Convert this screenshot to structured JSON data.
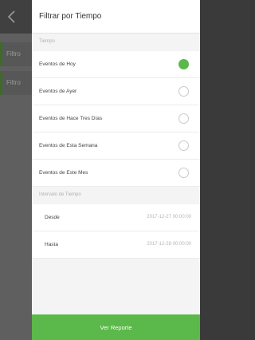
{
  "background_page": {
    "tab1_label": "Filtro",
    "tab2_label": "Filtro"
  },
  "panel": {
    "title": "Filtrar por Tiempo",
    "time_section_label": "Tiempo",
    "time_options": [
      {
        "label": "Eventos de Hoy",
        "selected": true
      },
      {
        "label": "Eventos de Ayer",
        "selected": false
      },
      {
        "label": "Eventos de Hace Tres Días",
        "selected": false
      },
      {
        "label": "Eventos de Esta Semana",
        "selected": false
      },
      {
        "label": "Eventos de Este Mes",
        "selected": false
      }
    ],
    "interval_section_label": "Intervalo de Tiempo",
    "from_label": "Desde",
    "from_value": "2017-12-27 00:00:00",
    "to_label": "Hasta",
    "to_value": "2017-12-28 00:00:00",
    "submit_label": "Ver Reporte"
  },
  "colors": {
    "accent": "#5bb84a",
    "overlay": "#3a3a3a"
  }
}
